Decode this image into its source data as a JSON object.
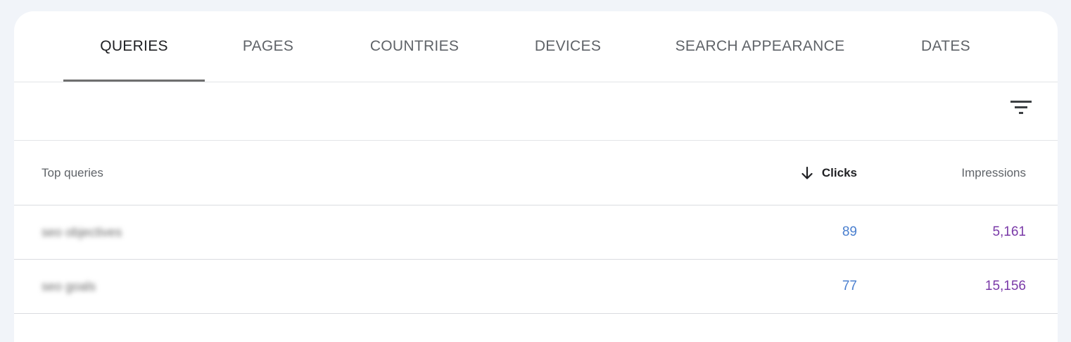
{
  "tabs": [
    {
      "label": "QUERIES",
      "active": true
    },
    {
      "label": "PAGES",
      "active": false
    },
    {
      "label": "COUNTRIES",
      "active": false
    },
    {
      "label": "DEVICES",
      "active": false
    },
    {
      "label": "SEARCH APPEARANCE",
      "active": false
    },
    {
      "label": "DATES",
      "active": false
    }
  ],
  "toolbar": {
    "filter_icon": "filter-icon"
  },
  "table": {
    "columns": {
      "query": "Top queries",
      "clicks": "Clicks",
      "impressions": "Impressions"
    },
    "sort_icon": "arrow-down-icon",
    "rows": [
      {
        "query": "seo objectives",
        "clicks": "89",
        "impressions": "5,161"
      },
      {
        "query": "seo goals",
        "clicks": "77",
        "impressions": "15,156"
      }
    ]
  },
  "colors": {
    "clicks": "#4a7fcf",
    "impressions": "#7a3aa8",
    "active_tab_indicator": "#6f6f6f"
  }
}
